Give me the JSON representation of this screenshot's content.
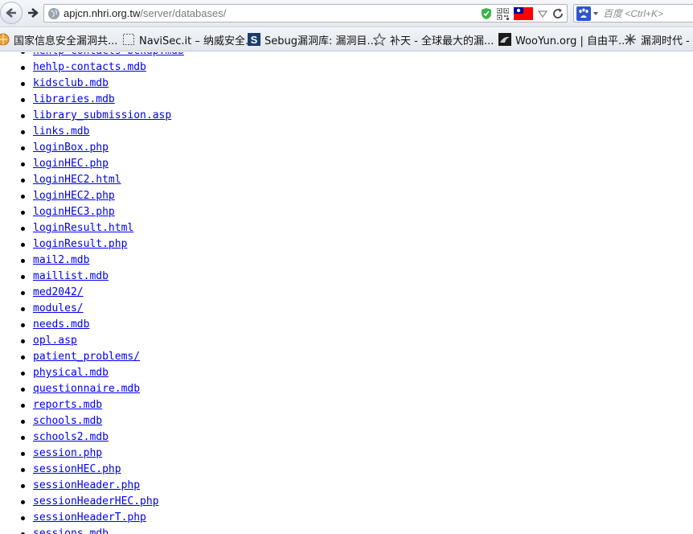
{
  "address_bar": {
    "host": "apjcn.nhri.org.tw",
    "path": "/server/databases/"
  },
  "search_bar": {
    "placeholder": "百度 <Ctrl+K>"
  },
  "bookmarks": [
    {
      "label": "国家信息安全漏洞共...",
      "icon": "globe-icon"
    },
    {
      "label": "NaviSec.it – 纳威安全...",
      "icon": "dotted-square-icon"
    },
    {
      "label": "Sebug漏洞库: 漏洞目...",
      "icon": "sebug-s-icon"
    },
    {
      "label": "补天 - 全球最大的漏...",
      "icon": "butian-icon"
    },
    {
      "label": "WooYun.org | 自由平...",
      "icon": "wooyun-icon"
    },
    {
      "label": "漏洞时代 - 最",
      "icon": "burst-icon"
    }
  ],
  "files": [
    "hehlp-contacts-bckup.mdb",
    "hehlp-contacts.mdb",
    "kidsclub.mdb",
    "libraries.mdb",
    "library_submission.asp",
    "links.mdb",
    "loginBox.php",
    "loginHEC.php",
    "loginHEC2.html",
    "loginHEC2.php",
    "loginHEC3.php",
    "loginResult.html",
    "loginResult.php",
    "mail2.mdb",
    "maillist.mdb",
    "med2042/",
    "modules/",
    "needs.mdb",
    "opl.asp",
    "patient_problems/",
    "physical.mdb",
    "questionnaire.mdb",
    "reports.mdb",
    "schools.mdb",
    "schools2.mdb",
    "session.php",
    "sessionHEC.php",
    "sessionHeader.php",
    "sessionHeaderHEC.php",
    "sessionHeaderT.php",
    "sessions.mdb"
  ],
  "colors": {
    "link": "#0000ee",
    "flag_red": "#fe0000",
    "flag_blue": "#000095",
    "shield_green": "#38b449"
  }
}
